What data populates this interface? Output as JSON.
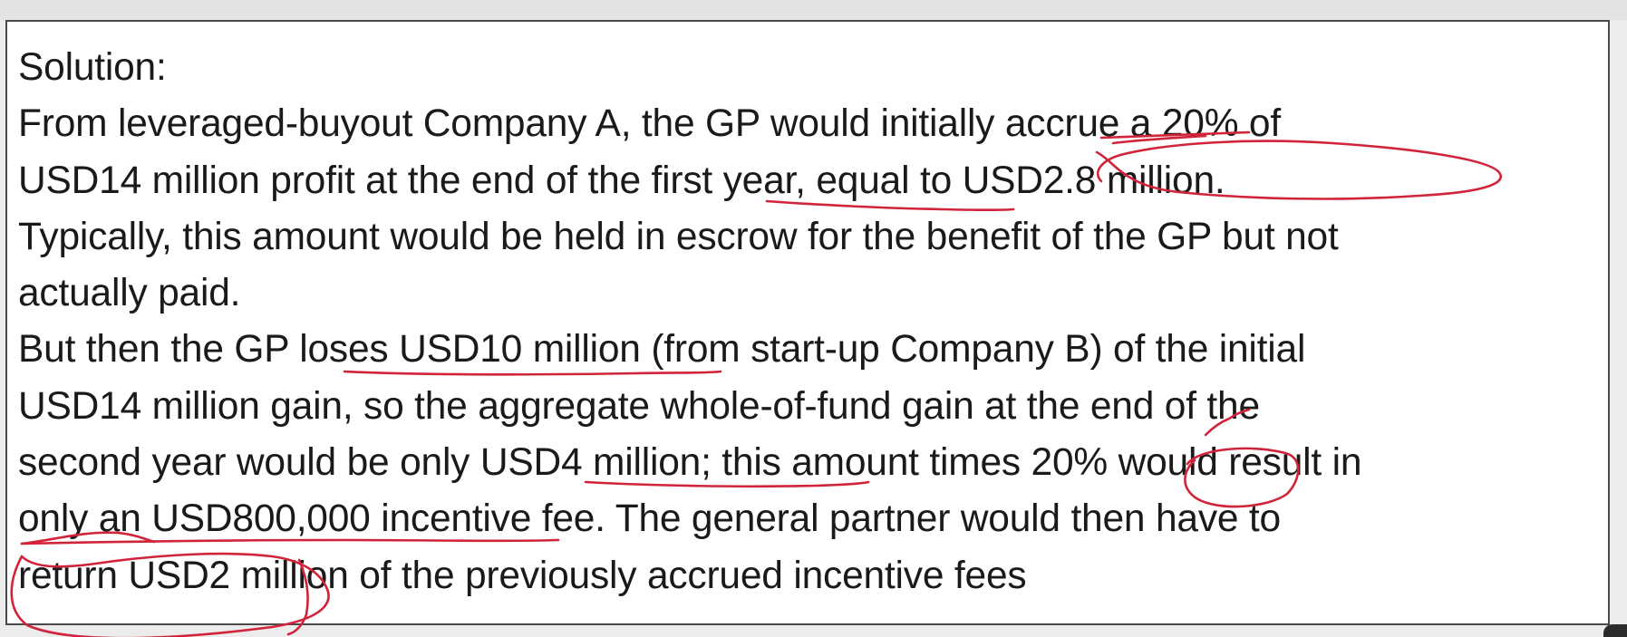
{
  "document": {
    "heading": "Solution:",
    "lines": [
      "From leveraged-buyout Company A, the GP would initially accrue a 20% of",
      "USD14 million profit at the end of the first year, equal to USD2.8 million.",
      "Typically, this amount would be held in escrow for the benefit of the GP but not",
      "actually paid.",
      "But then the GP loses USD10 million (from start-up Company B) of the initial",
      "USD14 million gain, so the aggregate whole-of-fund gain at the end of the",
      "second year would be only USD4 million; this amount times 20% would result in",
      "only an USD800,000 incentive fee. The general partner would then have to",
      "return USD2 million of the previously accrued incentive fees"
    ]
  },
  "annotations": {
    "ink_color": "#d1243a"
  }
}
